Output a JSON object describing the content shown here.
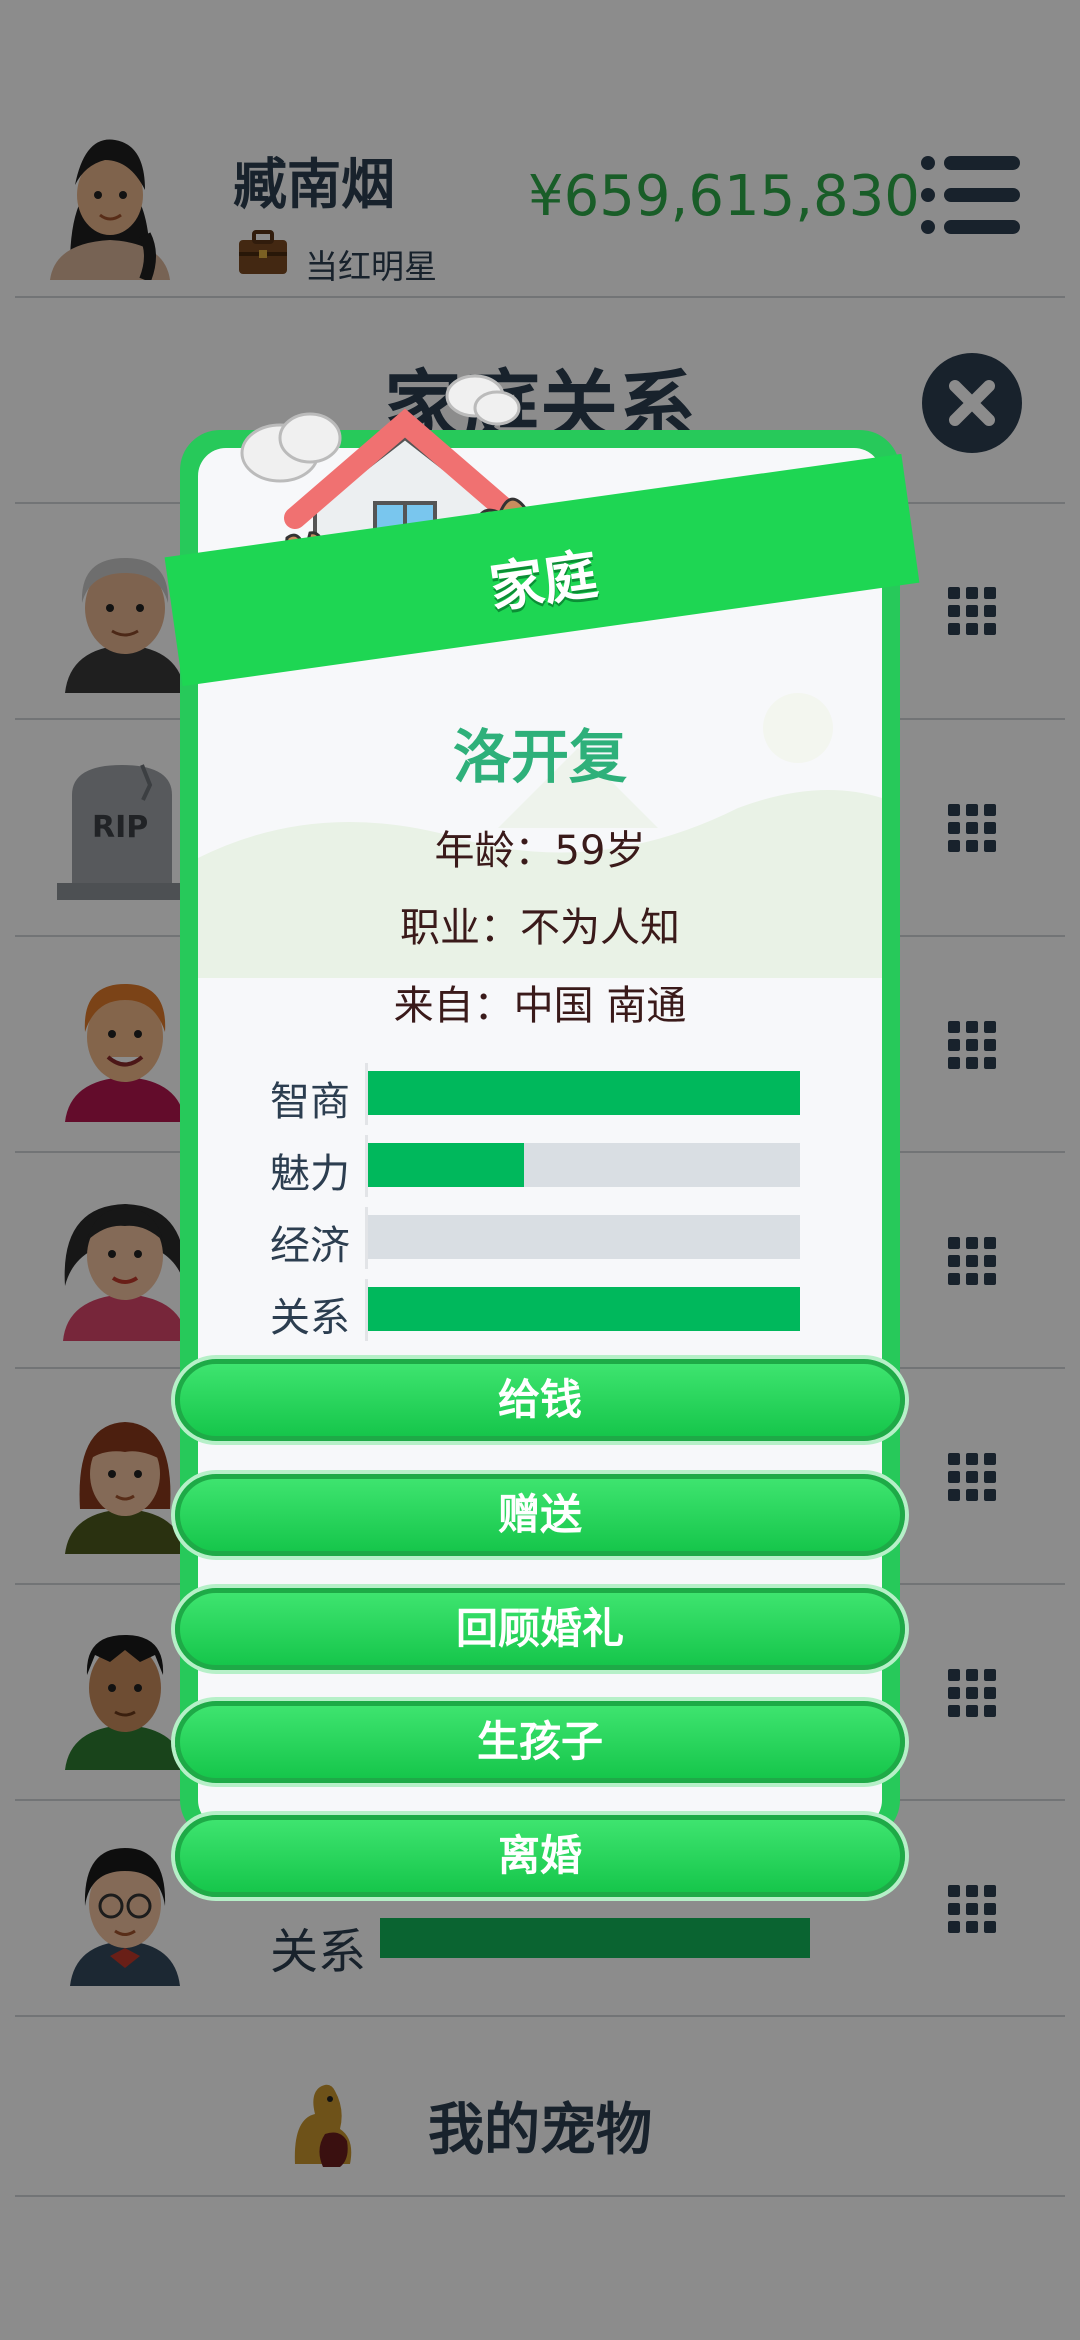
{
  "header": {
    "player_name": "臧南烟",
    "job_title": "当红明星",
    "money": "¥659,615,830"
  },
  "section": {
    "title": "家庭关系"
  },
  "background_list": {
    "relation_label": "关系",
    "relation_level": 1.0,
    "pet_label": "我的宠物",
    "rip_text": "RIP"
  },
  "modal": {
    "banner_title": "家庭",
    "person_name": "洛开复",
    "age_line": "年龄：59岁",
    "job_line": "职业：不为人知",
    "from_line": "来自：中国 南通",
    "stats": [
      {
        "label": "智商",
        "level": 1.0
      },
      {
        "label": "魅力",
        "level": 0.36
      },
      {
        "label": "经济",
        "level": 0.0
      },
      {
        "label": "关系",
        "level": 1.0
      }
    ],
    "buttons": [
      "给钱",
      "赠送",
      "回顾婚礼",
      "生孩子",
      "离婚"
    ]
  },
  "colors": {
    "accent_green": "#1ed653",
    "stat_green": "#00b85c",
    "money_green": "#2ea94a",
    "name_teal": "#2eb07a",
    "dark_text": "#2c3e50"
  },
  "icons": [
    "avatar-icon",
    "briefcase-icon",
    "menu-icon",
    "close-icon",
    "grid-icon",
    "house-icon",
    "dog-icon"
  ]
}
